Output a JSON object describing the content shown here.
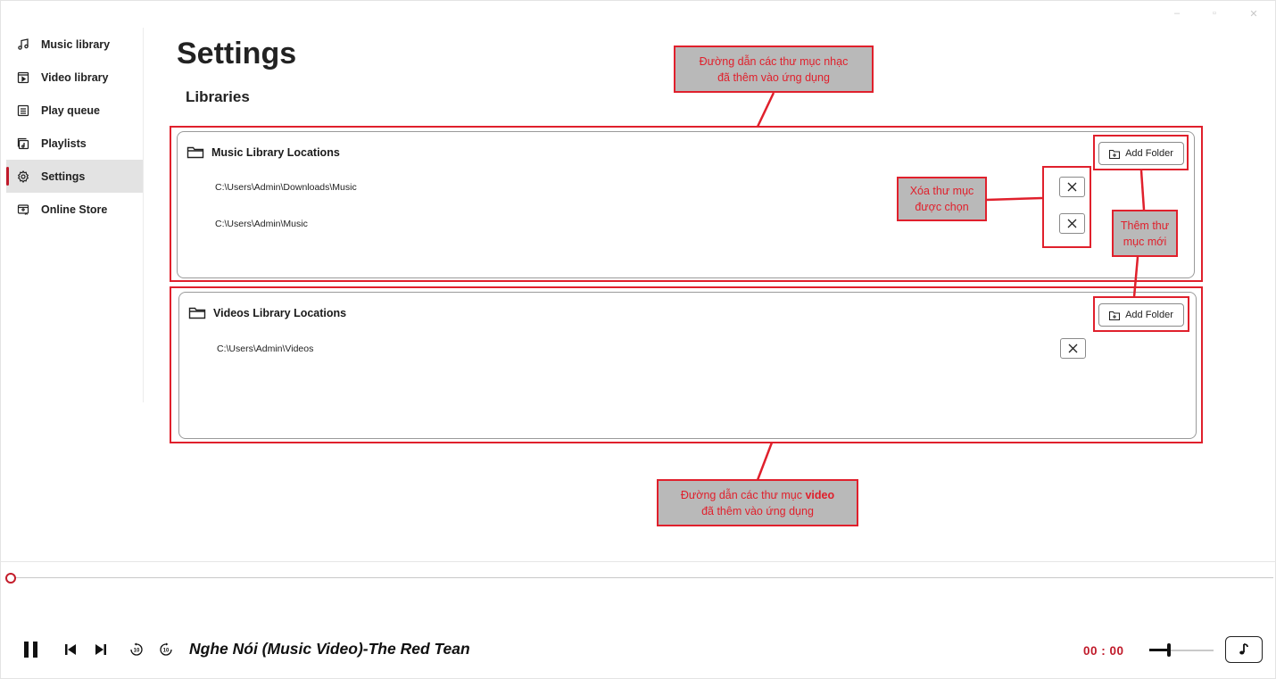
{
  "window": {
    "controls": [
      "–",
      "▫",
      "✕"
    ]
  },
  "sidebar": {
    "items": [
      {
        "label": "Music library",
        "icon": "music-note-icon"
      },
      {
        "label": "Video library",
        "icon": "video-icon"
      },
      {
        "label": "Play queue",
        "icon": "queue-icon"
      },
      {
        "label": "Playlists",
        "icon": "playlist-icon"
      },
      {
        "label": "Settings",
        "icon": "gear-icon",
        "active": true
      },
      {
        "label": "Online Store",
        "icon": "store-icon"
      }
    ]
  },
  "main": {
    "title": "Settings",
    "subtitle": "Libraries"
  },
  "music_panel": {
    "heading": "Music Library Locations",
    "add_label": "Add Folder",
    "paths": [
      "C:\\Users\\Admin\\Downloads\\Music",
      "C:\\Users\\Admin\\Music"
    ]
  },
  "video_panel": {
    "heading": "Videos Library Locations",
    "add_label": "Add Folder",
    "paths": [
      "C:\\Users\\Admin\\Videos"
    ]
  },
  "annotations": {
    "music_paths_line1": "Đường dẫn các thư mục nhạc",
    "music_paths_line2": "đã thêm vào ứng dụng",
    "remove_line1": "Xóa thư mục",
    "remove_line2": "được chọn",
    "add_line1": "Thêm thư",
    "add_line2": "mục mới",
    "video_paths_line1_pre": "Đường dẫn các thư mục ",
    "video_paths_line1_bold": "video",
    "video_paths_line2": "đã thêm vào ứng dụng",
    "color": "#e0202c"
  },
  "player": {
    "track_title": "Nghe Nói (Music Video)-The Red Tean",
    "time": "00 : 00",
    "seek_progress": 0,
    "volume": 0.3,
    "accent": "#c01a2a"
  }
}
